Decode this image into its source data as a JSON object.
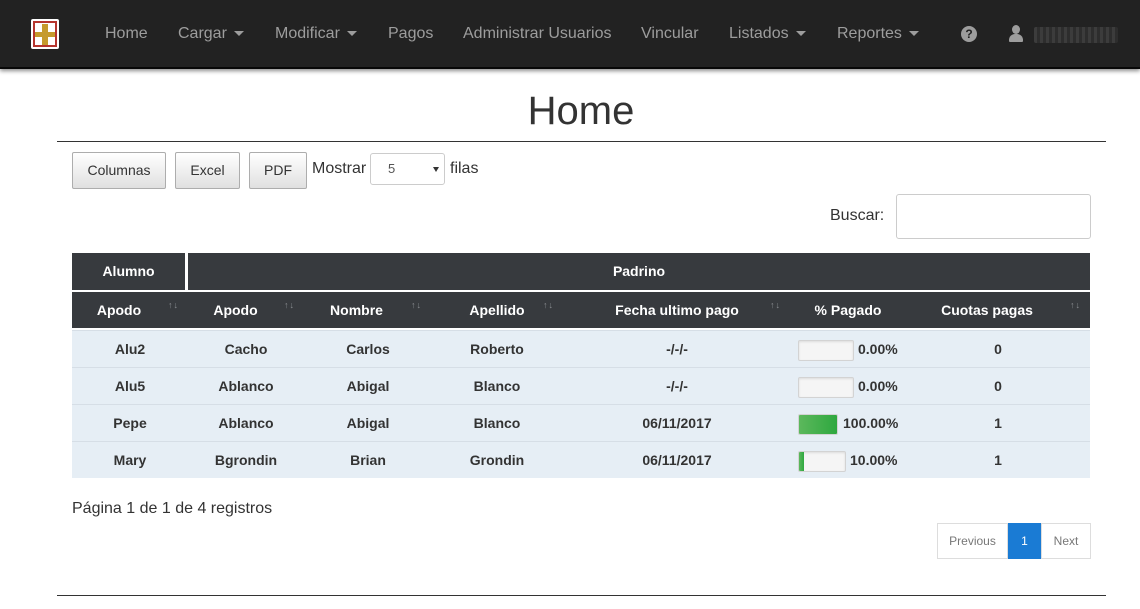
{
  "nav": {
    "items": [
      "Home",
      "Cargar",
      "Modificar",
      "Pagos",
      "Administrar Usuarios",
      "Vincular",
      "Listados",
      "Reportes"
    ],
    "help_icon": "?"
  },
  "page": {
    "title": "Home"
  },
  "toolbar": {
    "columnas": "Columnas",
    "excel": "Excel",
    "pdf": "PDF",
    "mostrar": "Mostrar",
    "rows_value": "5",
    "filas": "filas",
    "buscar": "Buscar:"
  },
  "table": {
    "group_headers": [
      "Alumno",
      "Padrino"
    ],
    "columns": [
      "Apodo",
      "Apodo",
      "Nombre",
      "Apellido",
      "Fecha ultimo pago",
      "% Pagado",
      "Cuotas pagas"
    ],
    "rows": [
      {
        "alumno": "Alu2",
        "apodo": "Cacho",
        "nombre": "Carlos",
        "apellido": "Roberto",
        "fecha": "-/-/-",
        "pagado": 0.0,
        "pagado_text": "0.00%",
        "cuotas": "0"
      },
      {
        "alumno": "Alu5",
        "apodo": "Ablanco",
        "nombre": "Abigal",
        "apellido": "Blanco",
        "fecha": "-/-/-",
        "pagado": 0.0,
        "pagado_text": "0.00%",
        "cuotas": "0"
      },
      {
        "alumno": "Pepe",
        "apodo": "Ablanco",
        "nombre": "Abigal",
        "apellido": "Blanco",
        "fecha": "06/11/2017",
        "pagado": 1.0,
        "pagado_text": "100.00%",
        "cuotas": "1"
      },
      {
        "alumno": "Mary",
        "apodo": "Bgrondin",
        "nombre": "Brian",
        "apellido": "Grondin",
        "fecha": "06/11/2017",
        "pagado": 0.1,
        "pagado_text": "10.00%",
        "cuotas": "1"
      }
    ]
  },
  "footer": {
    "info": "Página 1 de 1 de 4 registros",
    "previous": "Previous",
    "current_page": "1",
    "next": "Next"
  },
  "colors": {
    "navbar": "#222222",
    "header": "#373a3e",
    "row": "#e6eef5",
    "progress": "#5cb85c",
    "active_page": "#1a7bd4"
  }
}
